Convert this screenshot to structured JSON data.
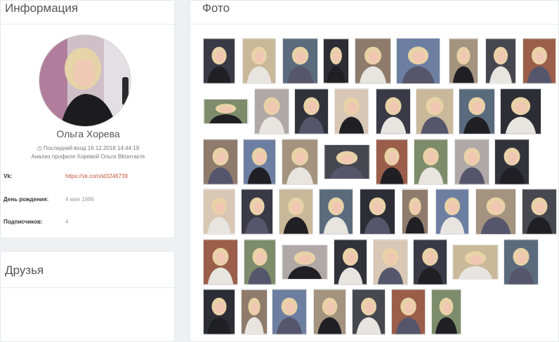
{
  "info": {
    "title": "Информация",
    "name": "Ольга Хорева",
    "last_login": "Последний вход 16.12.2018 14:44:19",
    "subtitle": "Анализ профиля Хоревой Ольги ВКонтакте",
    "rows": [
      {
        "label": "Vk:",
        "value": "https://vk.com/id3246739"
      },
      {
        "label": "День рождения:",
        "value": "4 мая 1986"
      },
      {
        "label": "Подписчиков:",
        "value": "4"
      }
    ]
  },
  "friends": {
    "title": "Друзья"
  },
  "photos": {
    "title": "Фото"
  },
  "colors": {
    "link": "#c9553d",
    "hair": "#e8d2a6",
    "skin": "#f1c7b4"
  }
}
